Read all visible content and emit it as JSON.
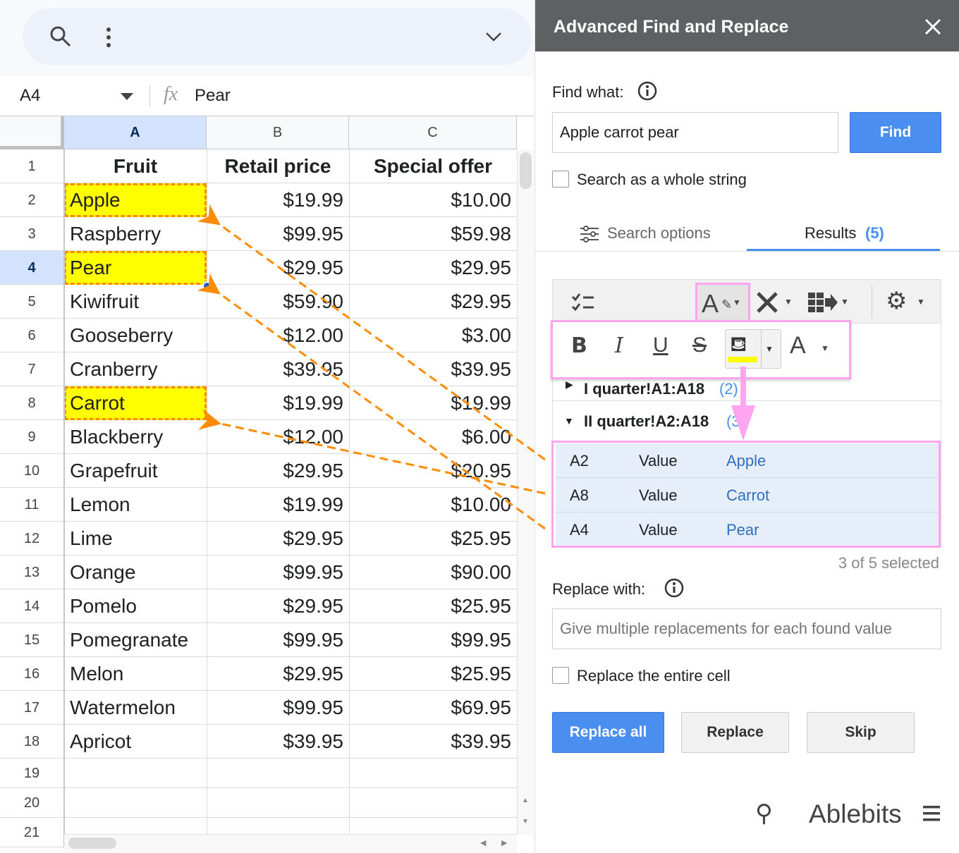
{
  "sheet": {
    "name_box": "A4",
    "formula_value": "Pear",
    "columns": [
      "A",
      "B",
      "C"
    ],
    "header_row": [
      "Fruit",
      "Retail price",
      "Special offer"
    ],
    "rows": [
      [
        "Apple",
        "$19.99",
        "$10.00"
      ],
      [
        "Raspberry",
        "$99.95",
        "$59.98"
      ],
      [
        "Pear",
        "$29.95",
        "$29.95"
      ],
      [
        "Kiwifruit",
        "$59.90",
        "$29.95"
      ],
      [
        "Gooseberry",
        "$12.00",
        "$3.00"
      ],
      [
        "Cranberry",
        "$39.95",
        "$39.95"
      ],
      [
        "Carrot",
        "$19.99",
        "$19.99"
      ],
      [
        "Blackberry",
        "$12.00",
        "$6.00"
      ],
      [
        "Grapefruit",
        "$29.95",
        "$20.95"
      ],
      [
        "Lemon",
        "$19.99",
        "$10.00"
      ],
      [
        "Lime",
        "$29.95",
        "$25.95"
      ],
      [
        "Orange",
        "$99.95",
        "$90.00"
      ],
      [
        "Pomelo",
        "$29.95",
        "$25.95"
      ],
      [
        "Pomegranate",
        "$99.95",
        "$99.95"
      ],
      [
        "Melon",
        "$29.95",
        "$25.95"
      ],
      [
        "Watermelon",
        "$99.95",
        "$69.95"
      ],
      [
        "Apricot",
        "$39.95",
        "$39.95"
      ]
    ],
    "row_numbers": [
      "1",
      "2",
      "3",
      "4",
      "5",
      "6",
      "7",
      "8",
      "9",
      "10",
      "11",
      "12",
      "13",
      "14",
      "15",
      "16",
      "17",
      "18",
      "19",
      "20",
      "21"
    ],
    "highlight_color": "#ffff00",
    "arrow_color": "#ff8c00"
  },
  "panel": {
    "title": "Advanced Find and Replace",
    "find_label": "Find what:",
    "find_value": "Apple carrot pear",
    "find_button": "Find",
    "whole_string_label": "Search as a whole string",
    "tab_search_options": "Search options",
    "tab_results": "Results",
    "tab_results_count": "(5)",
    "groups": [
      {
        "label": "I quarter!A1:A18",
        "count": "(2)"
      },
      {
        "label": "II quarter!A2:A18",
        "count": "(3)"
      }
    ],
    "results": [
      {
        "cell": "A2",
        "type": "Value",
        "value": "Apple"
      },
      {
        "cell": "A8",
        "type": "Value",
        "value": "Carrot"
      },
      {
        "cell": "A4",
        "type": "Value",
        "value": "Pear"
      }
    ],
    "selected_status": "3 of 5 selected",
    "replace_label": "Replace with:",
    "replace_placeholder": "Give multiple replacements for each found value",
    "entire_cell_label": "Replace the entire cell",
    "replace_all_button": "Replace all",
    "replace_button": "Replace",
    "skip_button": "Skip",
    "brand": "Ablebits",
    "accent_color": "#4285f4",
    "highlight_border_color": "#ffa5f0",
    "fill_color": "#ffff00"
  }
}
